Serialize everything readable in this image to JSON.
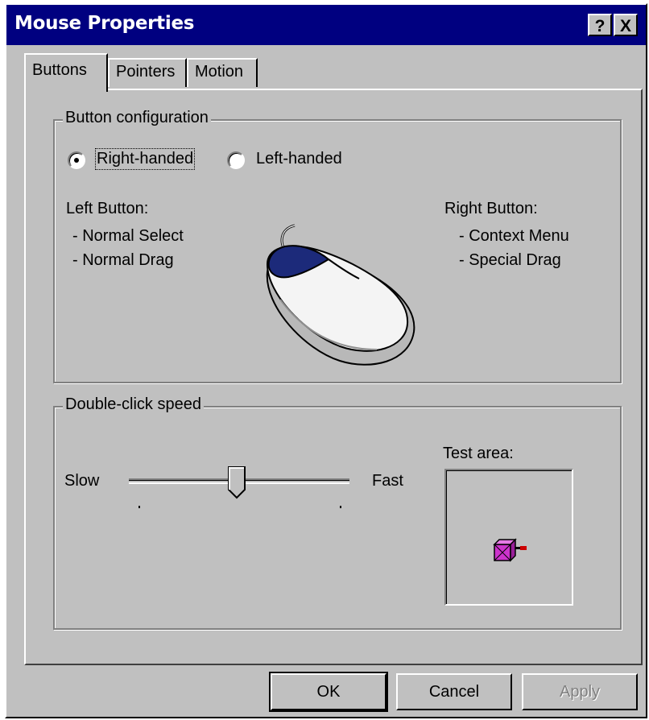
{
  "window": {
    "title": "Mouse Properties",
    "help_button": "?",
    "close_button": "X"
  },
  "tabs": [
    {
      "label": "Buttons",
      "active": true
    },
    {
      "label": "Pointers",
      "active": false
    },
    {
      "label": "Motion",
      "active": false
    }
  ],
  "button_configuration": {
    "legend": "Button configuration",
    "options": [
      {
        "label": "Right-handed",
        "selected": true
      },
      {
        "label": "Left-handed",
        "selected": false
      }
    ],
    "left_button": {
      "heading": "Left Button:",
      "items": [
        "- Normal Select",
        "- Normal Drag"
      ]
    },
    "right_button": {
      "heading": "Right Button:",
      "items": [
        "- Context Menu",
        "- Special Drag"
      ]
    }
  },
  "double_click": {
    "legend": "Double-click speed",
    "slow_label": "Slow",
    "fast_label": "Fast",
    "speed_fraction": 0.5,
    "test_area_label": "Test area:"
  },
  "buttons": {
    "ok": "OK",
    "cancel": "Cancel",
    "apply": "Apply"
  },
  "colors": {
    "titlebar": "#000080",
    "face": "#c0c0c0",
    "mouse_button_accent": "#1c2a7a",
    "test_box": "#cc33cc"
  }
}
